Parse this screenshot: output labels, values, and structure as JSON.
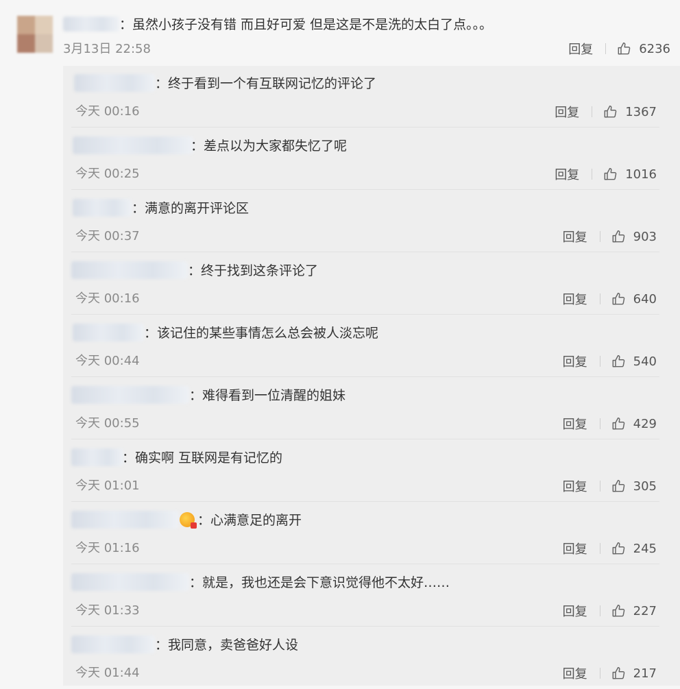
{
  "main_comment": {
    "text": "：虽然小孩子没有错 而且好可爱 但是这是不是洗的太白了点。。。",
    "time": "3月13日 22:58",
    "reply_label": "回复",
    "likes": "6236"
  },
  "replies": [
    {
      "text": "：终于看到一个有互联网记忆的评论了",
      "time": "今天 00:16",
      "reply_label": "回复",
      "likes": "1367"
    },
    {
      "text": "：差点以为大家都失忆了呢",
      "time": "今天 00:25",
      "reply_label": "回复",
      "likes": "1016"
    },
    {
      "text": "：满意的离开评论区",
      "time": "今天 00:37",
      "reply_label": "回复",
      "likes": "903"
    },
    {
      "text": "：终于找到这条评论了",
      "time": "今天 00:16",
      "reply_label": "回复",
      "likes": "640"
    },
    {
      "text": "：该记住的某些事情怎么总会被人淡忘呢",
      "time": "今天 00:44",
      "reply_label": "回复",
      "likes": "540"
    },
    {
      "text": "：难得看到一位清醒的姐妹",
      "time": "今天 00:55",
      "reply_label": "回复",
      "likes": "429"
    },
    {
      "text": "：确实啊 互联网是有记忆的",
      "time": "今天 01:01",
      "reply_label": "回复",
      "likes": "305"
    },
    {
      "text": "：心满意足的离开",
      "time": "今天 01:16",
      "reply_label": "回复",
      "likes": "245"
    },
    {
      "text": "：就是，我也还是会下意识觉得他不太好……",
      "time": "今天 01:33",
      "reply_label": "回复",
      "likes": "227"
    },
    {
      "text": "：我同意，卖爸爸好人设",
      "time": "今天 01:44",
      "reply_label": "回复",
      "likes": "217"
    }
  ],
  "icons": {
    "like": "thumbs-up-icon",
    "avatar": "avatar",
    "emoji_badge": "emoji-badge-icon"
  }
}
